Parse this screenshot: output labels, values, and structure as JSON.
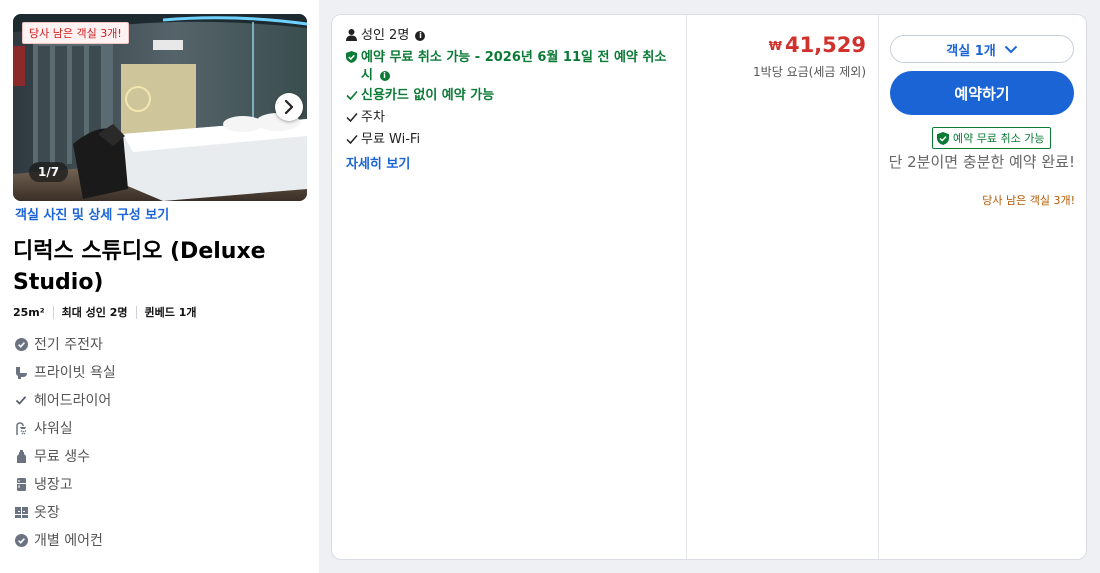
{
  "gallery": {
    "badge": "당사 남은 객실 3개!",
    "counter": "1/7",
    "link": "객실 사진 및 상세 구성 보기"
  },
  "room": {
    "title": "디럭스 스튜디오 (Deluxe Studio)",
    "specs": [
      "25m²",
      "최대 성인 2명",
      "퀸베드 1개"
    ],
    "amenities": [
      {
        "icon": "check-circle-icon",
        "label": "전기 주전자"
      },
      {
        "icon": "toilet-icon",
        "label": "프라이빗 욕실"
      },
      {
        "icon": "check-icon",
        "label": "헤어드라이어"
      },
      {
        "icon": "shower-icon",
        "label": "샤워실"
      },
      {
        "icon": "bottle-icon",
        "label": "무료 생수"
      },
      {
        "icon": "fridge-icon",
        "label": "냉장고"
      },
      {
        "icon": "wardrobe-icon",
        "label": "옷장"
      },
      {
        "icon": "check-circle-icon",
        "label": "개별 에어컨"
      }
    ]
  },
  "offer": {
    "guests": "성인 2명",
    "cancel_policy": "예약 무료 취소 가능 - 2026년 6월 11일 전 예약 취소 시",
    "no_card": "신용카드 없이 예약 가능",
    "parking": "주차",
    "wifi": "무료 Wi-Fi",
    "details_link": "자세히 보기"
  },
  "price": {
    "currency": "₩",
    "amount": "41,529",
    "note": "1박당 요금(세금 제외)"
  },
  "booking": {
    "room_select": "객실 1개",
    "book_button": "예약하기",
    "cancel_badge": "예약 무료 취소 가능",
    "quick_text": "단 2분이면 충분한 예약 완료!",
    "rooms_left": "당사 남은 객실 3개!"
  },
  "colors": {
    "accent": "#1a64d6",
    "price": "#d0312d",
    "success": "#0a7a35",
    "warning": "#b35900"
  }
}
